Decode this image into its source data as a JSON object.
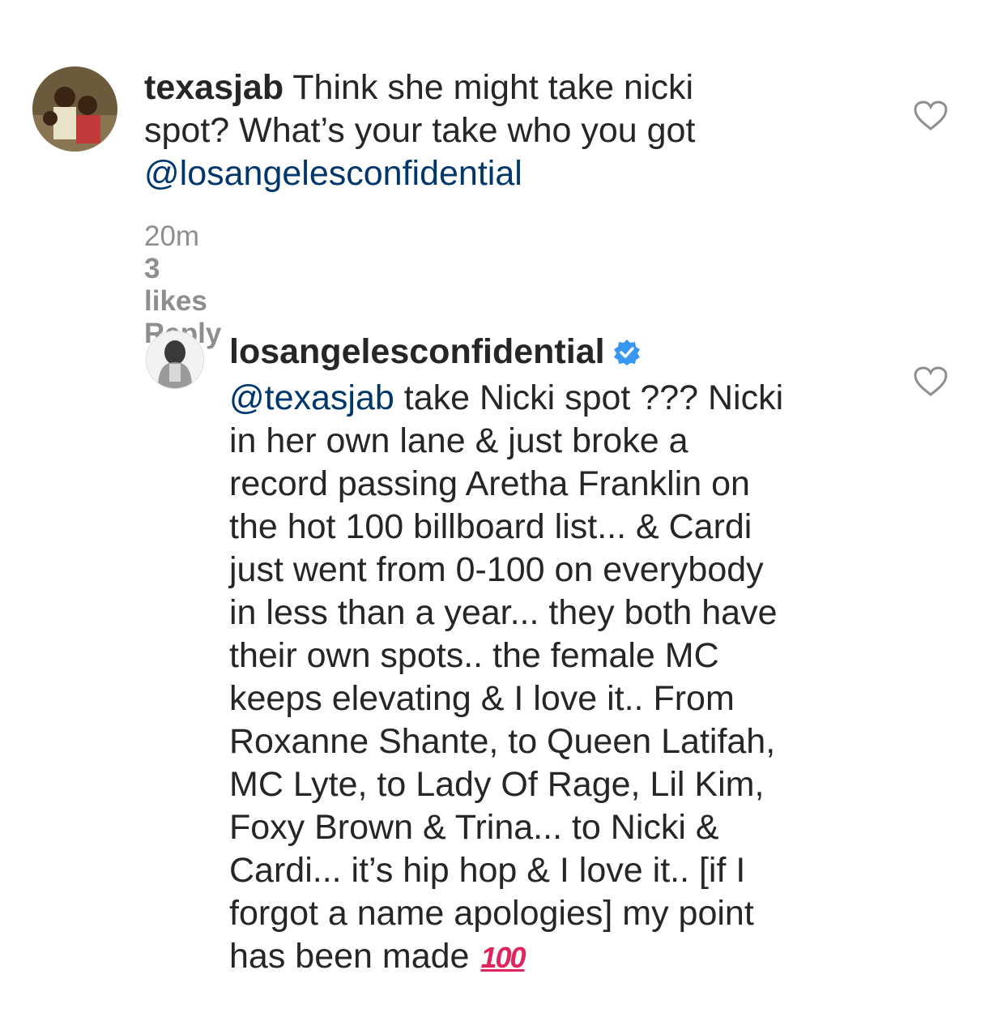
{
  "comment1": {
    "username": "texasjab",
    "line1": "Think she might take nicki",
    "line2": "spot? What’s your take who you got",
    "mention": "@losangelesconfidential",
    "time": "20m",
    "likes": "3 likes",
    "reply": "Reply",
    "avatar_icon": "avatar-photo-icon"
  },
  "comment2": {
    "username": "losangelesconfidential",
    "mention": "@texasjab",
    "lines": [
      "take Nicki spot ??? Nicki",
      "in her own lane & just broke a",
      "record passing Aretha Franklin on",
      "the hot 100 billboard list... & Cardi",
      "just went from 0-100 on everybody",
      "in less than a year... they both have",
      "their own spots.. the female MC",
      "keeps elevating & I love it.. From",
      "Roxanne Shante, to Queen Latifah,",
      "MC Lyte, to Lady Of Rage, Lil Kim,",
      "Foxy Brown & Trina... to Nicki &",
      "Cardi... it’s hip hop & I love it.. [if I",
      "forgot a name apologies] my point",
      "has been made"
    ],
    "emoji": "100"
  },
  "colors": {
    "text": "#262626",
    "mention": "#00376b",
    "meta": "#8e8e8e",
    "verified": "#3897f0"
  }
}
